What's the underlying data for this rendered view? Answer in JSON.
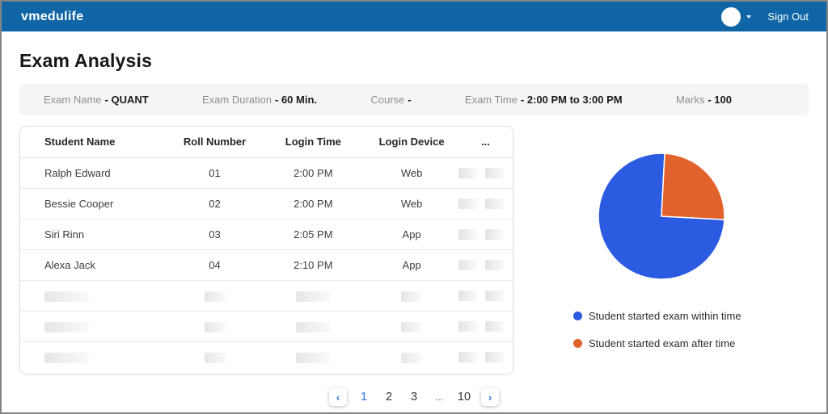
{
  "navbar": {
    "brand": "vmedulife",
    "sign_out_label": "Sign Out",
    "background_color": "#1065A6"
  },
  "page": {
    "title": "Exam Analysis"
  },
  "exam_info": {
    "items": [
      {
        "label": "Exam Name",
        "value": "QUANT"
      },
      {
        "label": "Exam Duration",
        "value": "60 Min."
      },
      {
        "label": "Course",
        "value": ""
      },
      {
        "label": "Exam Time",
        "value": "2:00 PM to 3:00 PM"
      },
      {
        "label": "Marks",
        "value": "100"
      }
    ]
  },
  "table": {
    "columns": [
      "Student Name",
      "Roll Number",
      "Login Time",
      "Login Device",
      "..."
    ],
    "rows": [
      {
        "placeholder": false,
        "student_name": "Ralph Edward",
        "roll_number": "01",
        "login_time": "2:00 PM",
        "login_device": "Web"
      },
      {
        "placeholder": false,
        "student_name": "Bessie Cooper",
        "roll_number": "02",
        "login_time": "2:00 PM",
        "login_device": "Web"
      },
      {
        "placeholder": false,
        "student_name": "Siri Rinn",
        "roll_number": "03",
        "login_time": "2:05 PM",
        "login_device": "App"
      },
      {
        "placeholder": false,
        "student_name": "Alexa Jack",
        "roll_number": "04",
        "login_time": "2:10 PM",
        "login_device": "App"
      },
      {
        "placeholder": true
      },
      {
        "placeholder": true
      },
      {
        "placeholder": true
      }
    ]
  },
  "pagination": {
    "prev_icon": "‹",
    "next_icon": "›",
    "pages": [
      "1",
      "2",
      "3",
      "...",
      "10"
    ],
    "active_page": "1"
  },
  "chart_data": {
    "type": "pie",
    "labels": [
      "Student started exam within time",
      "Student started exam after time"
    ],
    "values": [
      75,
      25
    ],
    "colors": [
      "#2B5BE0",
      "#E2622B"
    ],
    "start_angle_deg": 93,
    "legend_position": "below-left",
    "slice_border_color": "#ffffff"
  }
}
